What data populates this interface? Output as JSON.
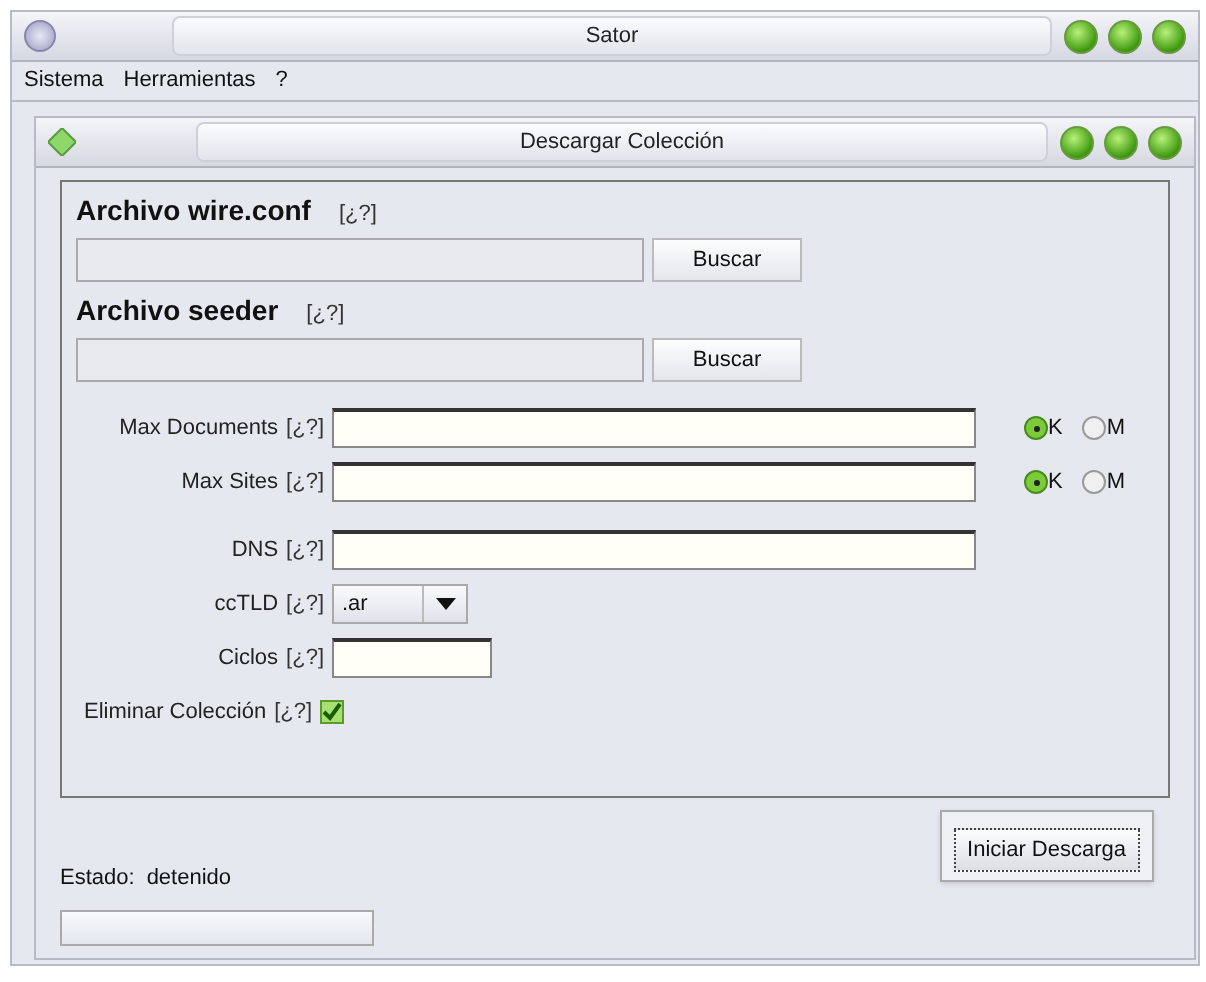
{
  "window": {
    "title": "Sator"
  },
  "menu": [
    "Sistema",
    "Herramientas",
    "?"
  ],
  "dialog": {
    "title": "Descargar Colección"
  },
  "file_sections": [
    {
      "title": "Archivo wire.conf",
      "help": "[¿?]",
      "button": "Buscar"
    },
    {
      "title": "Archivo seeder",
      "help": "[¿?]",
      "button": "Buscar"
    }
  ],
  "fields": [
    {
      "kind": "number",
      "label": "Max Documents",
      "help": "[¿?]",
      "options": [
        {
          "label": "K",
          "selected": true
        },
        {
          "label": "M",
          "selected": false
        }
      ]
    },
    {
      "kind": "number",
      "label": "Max Sites",
      "help": "[¿?]",
      "options": [
        {
          "label": "K",
          "selected": true
        },
        {
          "label": "M",
          "selected": false
        }
      ]
    },
    {
      "kind": "text",
      "label": "DNS",
      "help": "[¿?]"
    },
    {
      "kind": "select",
      "label": "ccTLD",
      "help": "[¿?]",
      "value": ".ar"
    },
    {
      "kind": "short",
      "label": "Ciclos",
      "help": "[¿?]"
    },
    {
      "kind": "checkbox",
      "label": "Eliminar Colección",
      "help": "[¿?]",
      "checked": true
    }
  ],
  "start_button": "Iniciar Descarga",
  "status": {
    "label": "Estado:",
    "value": "detenido",
    "level": 0
  }
}
